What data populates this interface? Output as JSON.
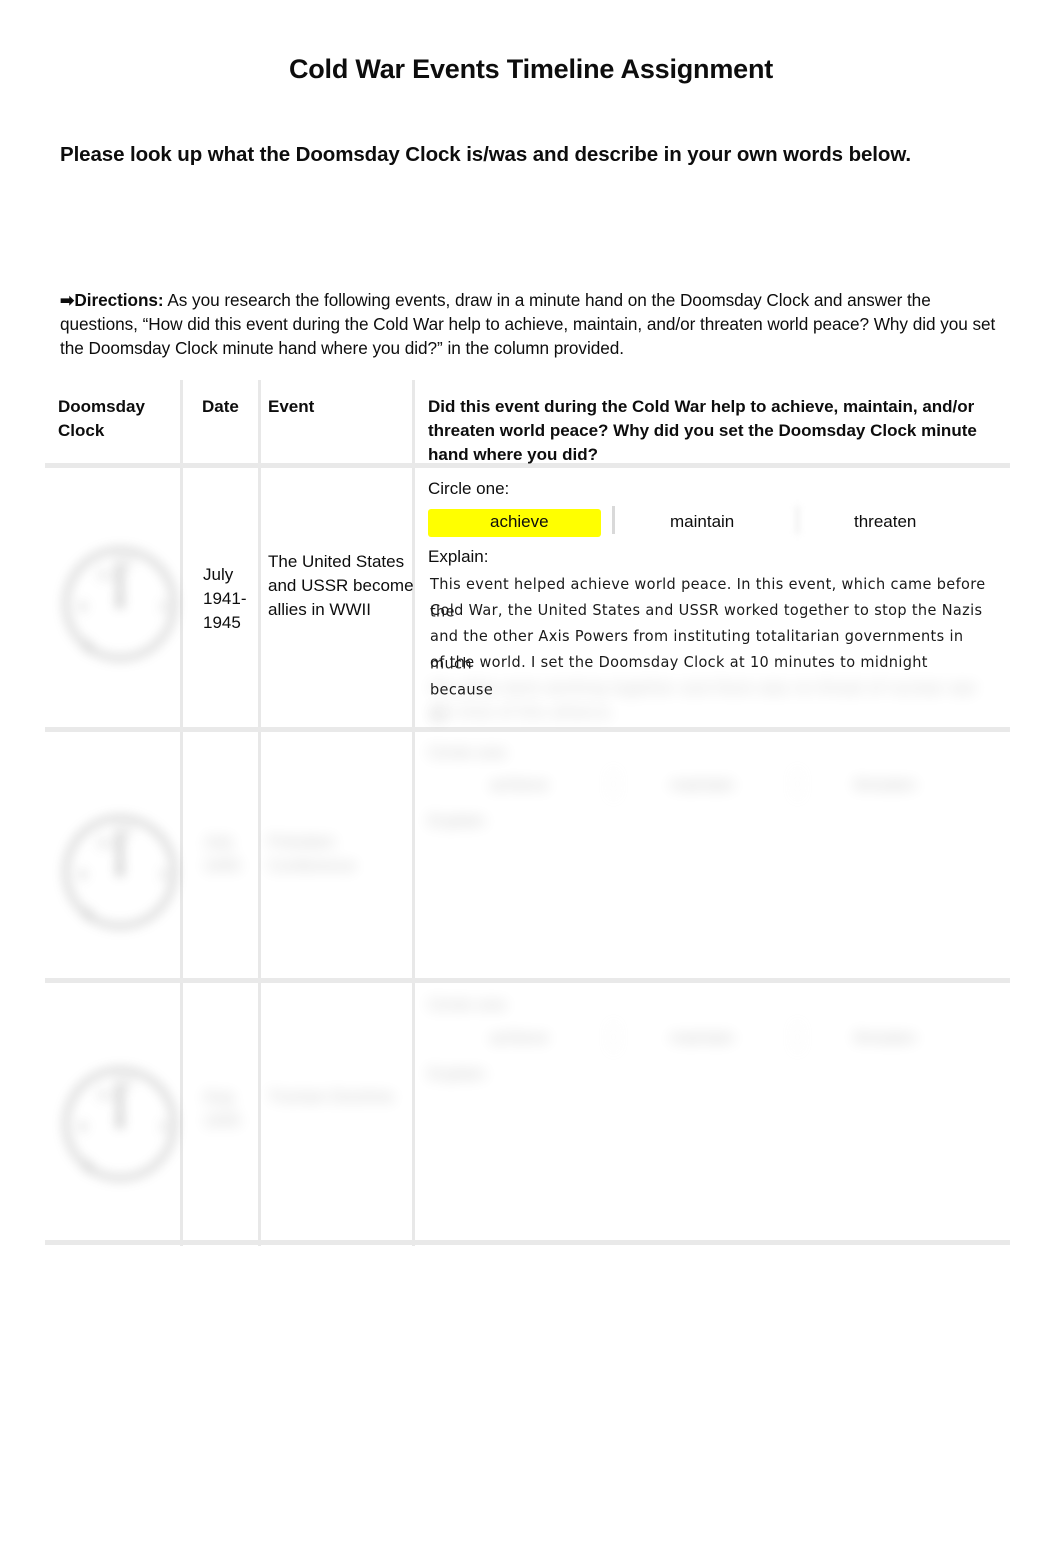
{
  "document": {
    "title": "Cold War Events Timeline Assignment",
    "prompt": "Please look up what the Doomsday Clock is/was and describe in your own words below.",
    "directions": {
      "arrow": "➡",
      "label": "Directions:",
      "text": " As you research the following events, draw in a minute hand on the Doomsday Clock and answer the questions, “How did this event during the Cold War help to achieve, maintain, and/or threaten world peace? Why did you set the Doomsday Clock minute hand where you did?” in the column provided."
    }
  },
  "table": {
    "headers": {
      "clock": "Doomsday Clock",
      "date": "Date",
      "event": "Event",
      "question": "Did this event during the Cold War help to achieve, maintain, and/or threaten world peace? Why did you set the Doomsday Clock minute hand where you did?"
    },
    "labels": {
      "circle_one": "Circle one:",
      "explain": "Explain:",
      "option_achieve": "achieve",
      "option_maintain": "maintain",
      "option_threaten": "threaten"
    },
    "highlight_color": "#ffff00",
    "rows": [
      {
        "date": "July 1941-1945",
        "event": "The United States and USSR become allies in WWII",
        "selected_option": "achieve",
        "explanation_lines": [
          "This event helped achieve world peace. In this event, which came before the",
          "Cold War, the United States and USSR worked together to stop the Nazis",
          "and the other Axis Powers from instituting totalitarian governments in much",
          "of the world. I set the Doomsday Clock at 10 minutes to midnight because",
          "the allies were working together and there was no threat of nuclear war at",
          "the time of this alliance."
        ],
        "clock_minutes_to_midnight": "10",
        "obscured": false
      },
      {
        "date": "",
        "event": "",
        "selected_option": "",
        "explanation_lines": [],
        "clock_minutes_to_midnight": "",
        "obscured": true
      },
      {
        "date": "",
        "event": "",
        "selected_option": "",
        "explanation_lines": [],
        "clock_minutes_to_midnight": "",
        "obscured": true
      }
    ]
  }
}
